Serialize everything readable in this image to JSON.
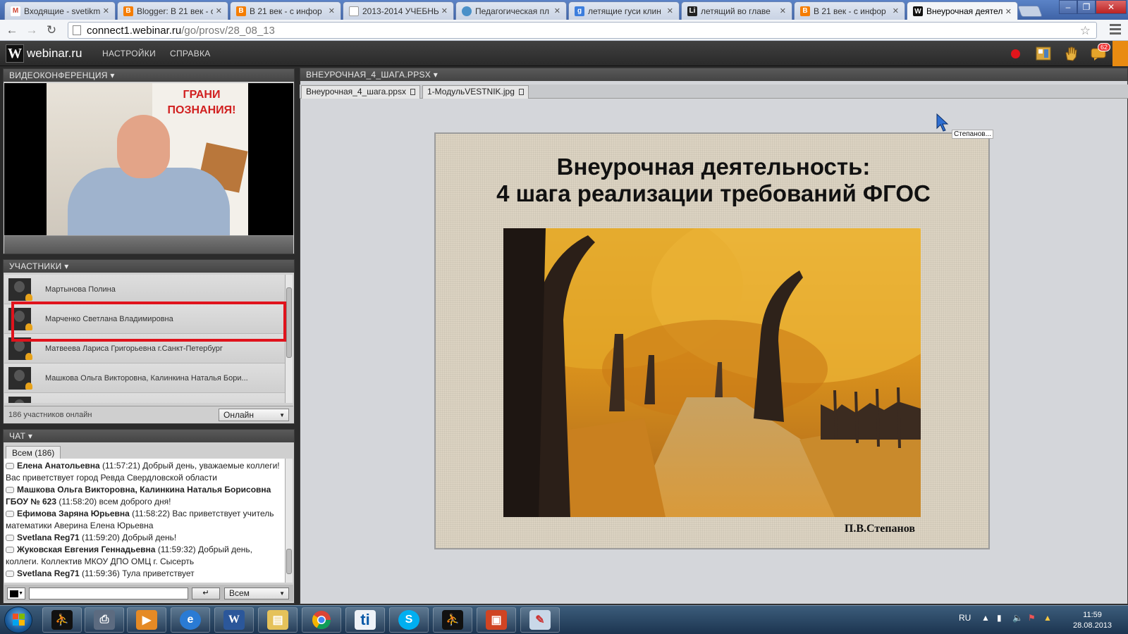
{
  "browser": {
    "tabs": [
      {
        "title": "Входящие - svetikm",
        "icon_color": "#d14836",
        "icon_letter": "M"
      },
      {
        "title": "Blogger: В 21 век - с",
        "icon_color": "#f57d00",
        "icon_letter": "B"
      },
      {
        "title": "В 21 век - с инфор",
        "icon_color": "#f57d00",
        "icon_letter": "B"
      },
      {
        "title": "2013-2014 УЧЕБНЫ",
        "icon_color": "#ffffff",
        "icon_letter": ""
      },
      {
        "title": "Педагогическая пл",
        "icon_color": "#4a90c8",
        "icon_letter": ""
      },
      {
        "title": "летящие гуси клин",
        "icon_color": "#3b7ddd",
        "icon_letter": "g"
      },
      {
        "title": "летящий во главе",
        "icon_color": "#222222",
        "icon_letter": "Li"
      },
      {
        "title": "В 21 век - с инфор",
        "icon_color": "#f57d00",
        "icon_letter": "B"
      },
      {
        "title": "Внеурочная деятел",
        "icon_color": "#111111",
        "icon_letter": "W"
      }
    ],
    "url_host": "connect1.webinar.ru",
    "url_path": "/go/prosv/28_08_13"
  },
  "app": {
    "logo_letter": "W",
    "logo_text": "webinar.ru",
    "menu": [
      "НАСТРОЙКИ",
      "СПРАВКА"
    ],
    "notifications_count": "62"
  },
  "video_panel": {
    "title": "ВИДЕОКОНФЕРЕНЦИЯ ▾",
    "banner_text": "ГРАНИ ПОЗНАНИЯ!"
  },
  "participants_panel": {
    "title": "УЧАСТНИКИ ▾",
    "items": [
      "Мартынова Полина",
      "Марченко Светлана Владимировна",
      "Матвеева Лариса Григорьевна г.Санкт-Петербург",
      "Машкова Ольга Викторовна, Калинкина Наталья Бори..."
    ],
    "count_text": "186 участников онлайн",
    "status": "Онлайн"
  },
  "chat_panel": {
    "title": "ЧАТ ▾",
    "tab": "Всем (186)",
    "messages": [
      {
        "author": "Елена Анатольевна",
        "time": " (11:57:21) ",
        "text": "Добрый день, уважаемые коллеги! Вас приветствует город Ревда Свердловской области"
      },
      {
        "author": "Машкова Ольга Викторовна, Калинкина Наталья Борисовна ГБОУ № 623",
        "time": " (11:58:20) ",
        "text": "всем доброго дня!"
      },
      {
        "author": "Ефимова Заряна Юрьевна",
        "time": " (11:58:22) ",
        "text": "Вас приветствует учитель математики Аверина Елена Юрьевна"
      },
      {
        "author": "Svetlana Reg71",
        "time": " (11:59:20) ",
        "text": "Добрый день!"
      },
      {
        "author": "Жуковская Евгения Геннадьевна",
        "time": " (11:59:32) ",
        "text": "Добрый день, коллеги. Коллектив МКОУ ДПО ОМЦ г. Сысерть"
      },
      {
        "author": "Svetlana Reg71",
        "time": " (11:59:36) ",
        "text": "Тула приветствует"
      }
    ],
    "send_label": "↵",
    "recipient": "Всем"
  },
  "presentation": {
    "title": "ВНЕУРОЧНАЯ_4_ШАГА.PPSX ▾",
    "doc_tabs": [
      "Внеурочная_4_шага.ppsx",
      "1-МодульVESTNIK.jpg"
    ],
    "slide_title_line1": "Внеурочная деятельность:",
    "slide_title_line2": "4 шага реализации требований ФГОС",
    "slide_author": "П.В.Степанов",
    "cursor_label": "Степанов..."
  },
  "taskbar": {
    "language": "RU",
    "time": "11:59",
    "date": "28.08.2013"
  }
}
